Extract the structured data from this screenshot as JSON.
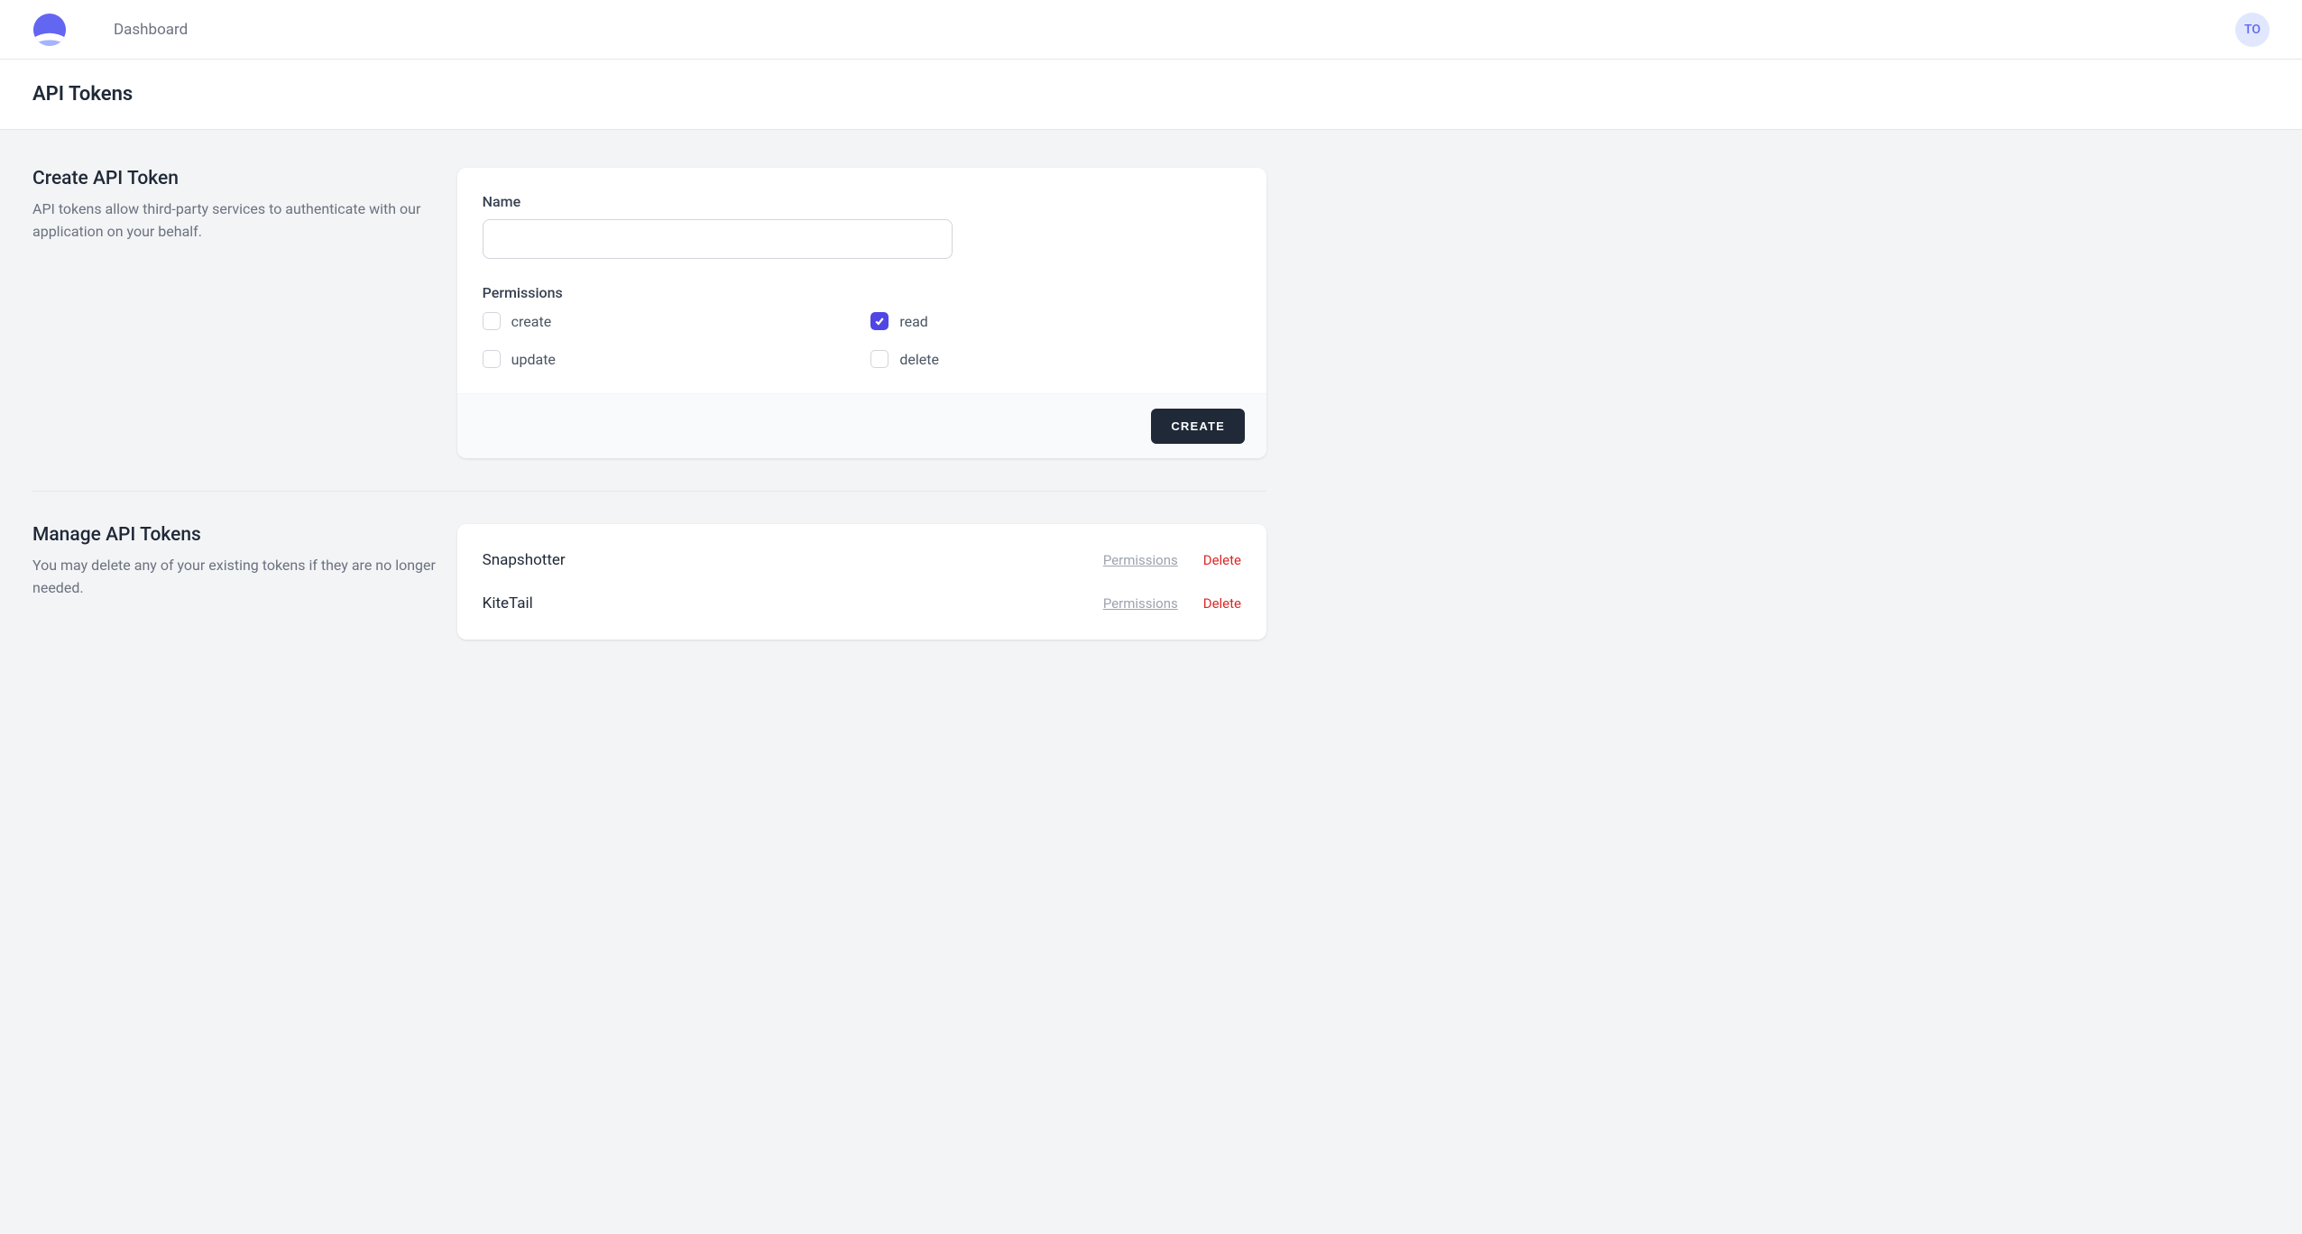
{
  "nav": {
    "dashboard": "Dashboard"
  },
  "user": {
    "initials": "TO"
  },
  "page": {
    "title": "API Tokens"
  },
  "create": {
    "heading": "Create API Token",
    "description": "API tokens allow third-party services to authenticate with our application on your behalf.",
    "name_label": "Name",
    "name_value": "",
    "permissions_label": "Permissions",
    "permissions": [
      {
        "key": "create",
        "label": "create",
        "checked": false
      },
      {
        "key": "read",
        "label": "read",
        "checked": true
      },
      {
        "key": "update",
        "label": "update",
        "checked": false
      },
      {
        "key": "delete",
        "label": "delete",
        "checked": false
      }
    ],
    "submit_label": "Create"
  },
  "manage": {
    "heading": "Manage API Tokens",
    "description": "You may delete any of your existing tokens if they are no longer needed.",
    "permissions_link": "Permissions",
    "delete_link": "Delete",
    "tokens": [
      {
        "name": "Snapshotter"
      },
      {
        "name": "KiteTail"
      }
    ]
  }
}
